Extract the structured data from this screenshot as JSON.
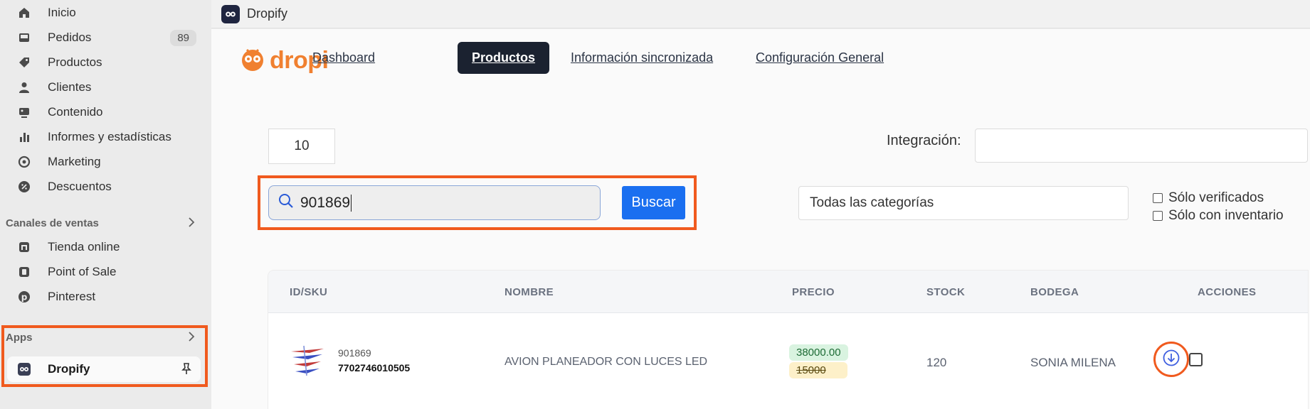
{
  "sidebar": {
    "items": [
      {
        "label": "Inicio",
        "icon": "home-icon"
      },
      {
        "label": "Pedidos",
        "icon": "inbox-icon",
        "badge": "89"
      },
      {
        "label": "Productos",
        "icon": "tag-icon"
      },
      {
        "label": "Clientes",
        "icon": "person-icon"
      },
      {
        "label": "Contenido",
        "icon": "image-icon"
      },
      {
        "label": "Informes y estadísticas",
        "icon": "bar-chart-icon"
      },
      {
        "label": "Marketing",
        "icon": "target-icon"
      },
      {
        "label": "Descuentos",
        "icon": "discount-icon"
      }
    ],
    "sales_channels_label": "Canales de ventas",
    "sales_channels": [
      {
        "label": "Tienda online",
        "icon": "store-icon"
      },
      {
        "label": "Point of Sale",
        "icon": "pos-icon"
      },
      {
        "label": "Pinterest",
        "icon": "pinterest-icon"
      }
    ],
    "apps_label": "Apps",
    "apps": [
      {
        "label": "Dropify",
        "icon": "dropify-app-icon"
      }
    ]
  },
  "topbar": {
    "title": "Dropify"
  },
  "brand": {
    "name": "dropi",
    "color": "#f08030"
  },
  "tabs": [
    {
      "label": "Dashboard",
      "active": false
    },
    {
      "label": "Productos",
      "active": true
    },
    {
      "label": "Información sincronizada",
      "active": false
    },
    {
      "label": "Configuración General",
      "active": false
    }
  ],
  "filters": {
    "per_page": "10",
    "integration_label": "Integración:",
    "integration_value": "",
    "search_value": "901869",
    "search_button": "Buscar",
    "category_value": "Todas las categorías",
    "only_verified": "Sólo verificados",
    "only_inventory": "Sólo con inventario"
  },
  "table": {
    "headers": {
      "id_sku": "ID/SKU",
      "nombre": "NOMBRE",
      "precio": "PRECIO",
      "stock": "STOCK",
      "bodega": "BODEGA",
      "acciones": "ACCIONES"
    },
    "rows": [
      {
        "id": "901869",
        "sku": "7702746010505",
        "nombre": "AVION PLANEADOR CON LUCES LED",
        "precio_nuevo": "38000.00",
        "precio_anterior": "15000",
        "stock": "120",
        "bodega": "SONIA MILENA"
      }
    ]
  },
  "colors": {
    "highlight": "#f05a1e",
    "primary_button": "#1a6ff0",
    "active_tab": "#1b2230"
  }
}
